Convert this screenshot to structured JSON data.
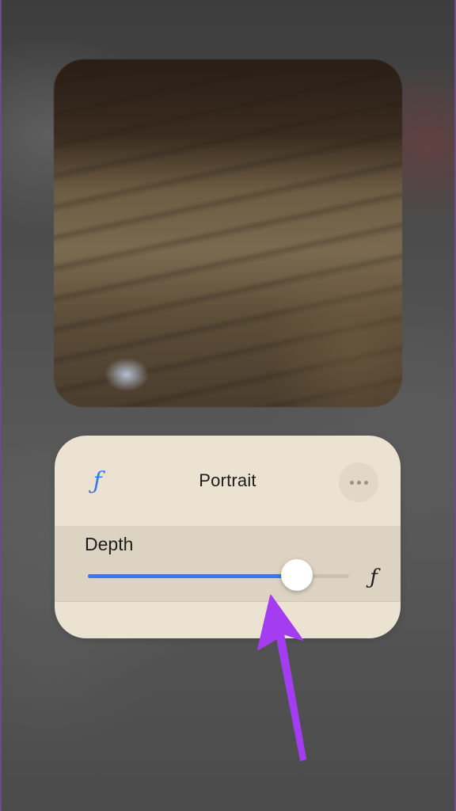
{
  "portrait_panel": {
    "title": "Portrait",
    "aperture_icon": "aperture-f-icon",
    "more_icon": "more-ellipsis-icon"
  },
  "depth": {
    "label": "Depth",
    "value_fraction": 0.8,
    "end_icon": "aperture-f-icon",
    "accent_color": "#3478f6"
  },
  "annotation": {
    "arrow_color": "#a43df2",
    "arrow_icon": "pointer-arrow"
  }
}
